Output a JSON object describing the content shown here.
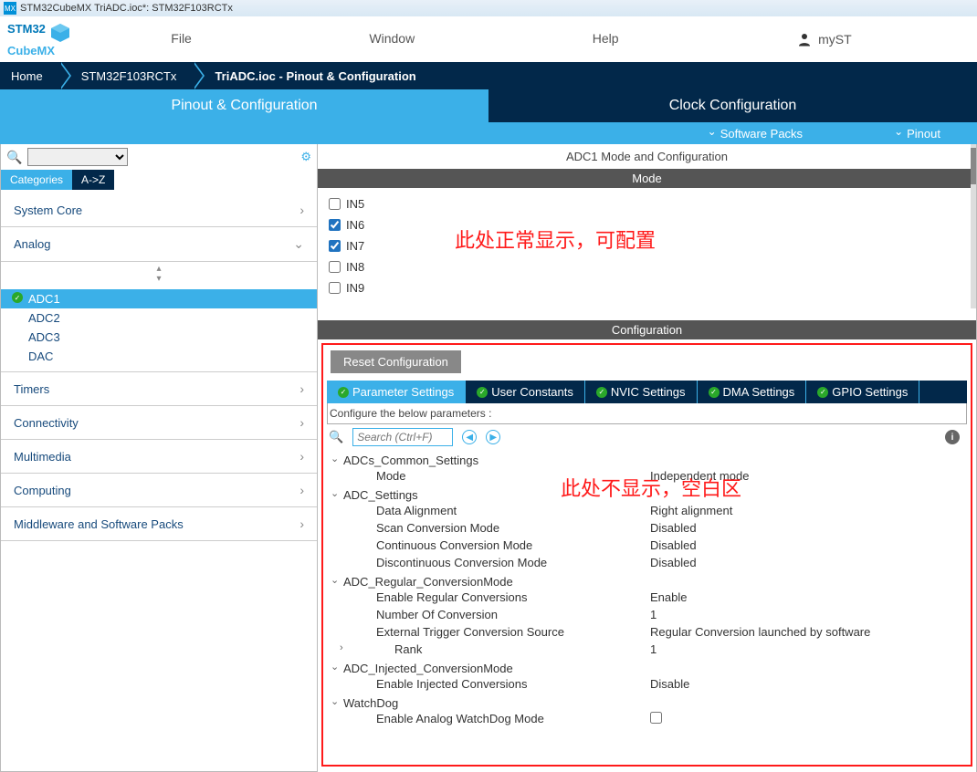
{
  "window_title": "STM32CubeMX TriADC.ioc*: STM32F103RCTx",
  "logo": {
    "line1": "STM32",
    "line2": "CubeMX"
  },
  "top_menu": {
    "file": "File",
    "window": "Window",
    "help": "Help",
    "myst": "mySТ"
  },
  "breadcrumb": {
    "home": "Home",
    "chip": "STM32F103RCTx",
    "project": "TriADC.ioc - Pinout & Configuration"
  },
  "maintabs": {
    "pinout": "Pinout & Configuration",
    "clock": "Clock Configuration"
  },
  "subbar": {
    "software_packs": "Software Packs",
    "pinout": "Pinout"
  },
  "sidebar": {
    "tabs": {
      "categories": "Categories",
      "az": "A->Z"
    },
    "groups": {
      "system_core": "System Core",
      "analog": "Analog",
      "timers": "Timers",
      "connectivity": "Connectivity",
      "multimedia": "Multimedia",
      "computing": "Computing",
      "middleware": "Middleware and Software Packs"
    },
    "analog_items": {
      "adc1": "ADC1",
      "adc2": "ADC2",
      "adc3": "ADC3",
      "dac": "DAC"
    }
  },
  "main": {
    "title": "ADC1 Mode and Configuration",
    "mode_hdr": "Mode",
    "channels": {
      "in5": "IN5",
      "in6": "IN6",
      "in7": "IN7",
      "in8": "IN8",
      "in9": "IN9"
    },
    "annotate1": "此处正常显示，可配置",
    "cfg_hdr": "Configuration",
    "reset": "Reset Configuration",
    "cfg_tabs": {
      "param": "Parameter Settings",
      "user": "User Constants",
      "nvic": "NVIC Settings",
      "dma": "DMA Settings",
      "gpio": "GPIO Settings"
    },
    "cfg_desc": "Configure the below parameters :",
    "search_ph": "Search (Ctrl+F)",
    "annotate2": "此处不显示，空白区",
    "params": {
      "g1": "ADCs_Common_Settings",
      "g1_mode_k": "Mode",
      "g1_mode_v": "Independent mode",
      "g2": "ADC_Settings",
      "g2_da_k": "Data Alignment",
      "g2_da_v": "Right alignment",
      "g2_scm_k": "Scan Conversion Mode",
      "g2_scm_v": "Disabled",
      "g2_ccm_k": "Continuous Conversion Mode",
      "g2_ccm_v": "Disabled",
      "g2_dcm_k": "Discontinuous Conversion Mode",
      "g2_dcm_v": "Disabled",
      "g3": "ADC_Regular_ConversionMode",
      "g3_erc_k": "Enable Regular Conversions",
      "g3_erc_v": "Enable",
      "g3_noc_k": "Number Of Conversion",
      "g3_noc_v": "1",
      "g3_etcs_k": "External Trigger Conversion Source",
      "g3_etcs_v": "Regular Conversion launched by software",
      "g3_rank_k": "Rank",
      "g3_rank_v": "1",
      "g4": "ADC_Injected_ConversionMode",
      "g4_eic_k": "Enable Injected Conversions",
      "g4_eic_v": "Disable",
      "g5": "WatchDog",
      "g5_eaw_k": "Enable Analog WatchDog Mode"
    }
  }
}
